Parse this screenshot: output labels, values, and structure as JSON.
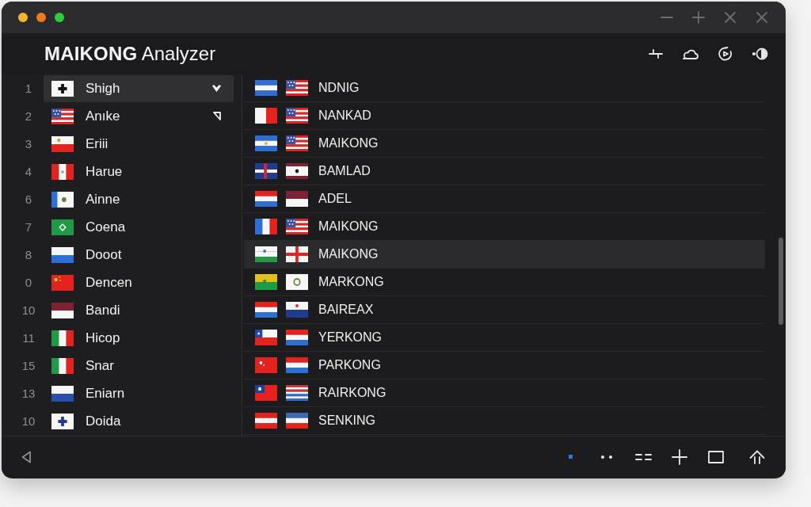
{
  "window": {
    "traffic_lights": [
      {
        "color": "#f5b52b"
      },
      {
        "color": "#f0781e"
      },
      {
        "color": "#2ecc3a"
      }
    ]
  },
  "header": {
    "title": "**MAIKONG** Analyzer"
  },
  "sidebar": {
    "items": [
      {
        "number": "1",
        "name": "Shigh",
        "selected": true,
        "expanded": true
      },
      {
        "number": "2",
        "name": "Anıke",
        "selected": false,
        "expanded": false
      },
      {
        "number": "3",
        "name": "Eriii",
        "selected": false
      },
      {
        "number": "4",
        "name": "Harue",
        "selected": false
      },
      {
        "number": "6",
        "name": "Ainne",
        "selected": false
      },
      {
        "number": "7",
        "name": "Coena",
        "selected": false
      },
      {
        "number": "8",
        "name": "Dooot",
        "selected": false
      },
      {
        "number": "0",
        "name": "Dencen",
        "selected": false
      },
      {
        "number": "10",
        "name": "Bandi",
        "selected": false
      },
      {
        "number": "11",
        "name": "Hicop",
        "selected": false
      },
      {
        "number": "15",
        "name": "Snar",
        "selected": false
      },
      {
        "number": "13",
        "name": "Eniarn",
        "selected": false
      },
      {
        "number": "10",
        "name": "Doida",
        "selected": false
      }
    ]
  },
  "list": {
    "rows": [
      {
        "label": "NDNIG",
        "selected": false
      },
      {
        "label": "NANKAD",
        "selected": false
      },
      {
        "label": "MAIKONG",
        "selected": false
      },
      {
        "label": "BAMLAD",
        "selected": false
      },
      {
        "label": "ADEL",
        "selected": false
      },
      {
        "label": "MAIKONG",
        "selected": false
      },
      {
        "label": "MAIKONG",
        "selected": true
      },
      {
        "label": "MARKONG",
        "selected": false
      },
      {
        "label": "BAIREAX",
        "selected": false
      },
      {
        "label": "YERKONG",
        "selected": false
      },
      {
        "label": "PARKONG",
        "selected": false
      },
      {
        "label": "RAIRKONG",
        "selected": false
      },
      {
        "label": "SENKING",
        "selected": false
      }
    ]
  }
}
